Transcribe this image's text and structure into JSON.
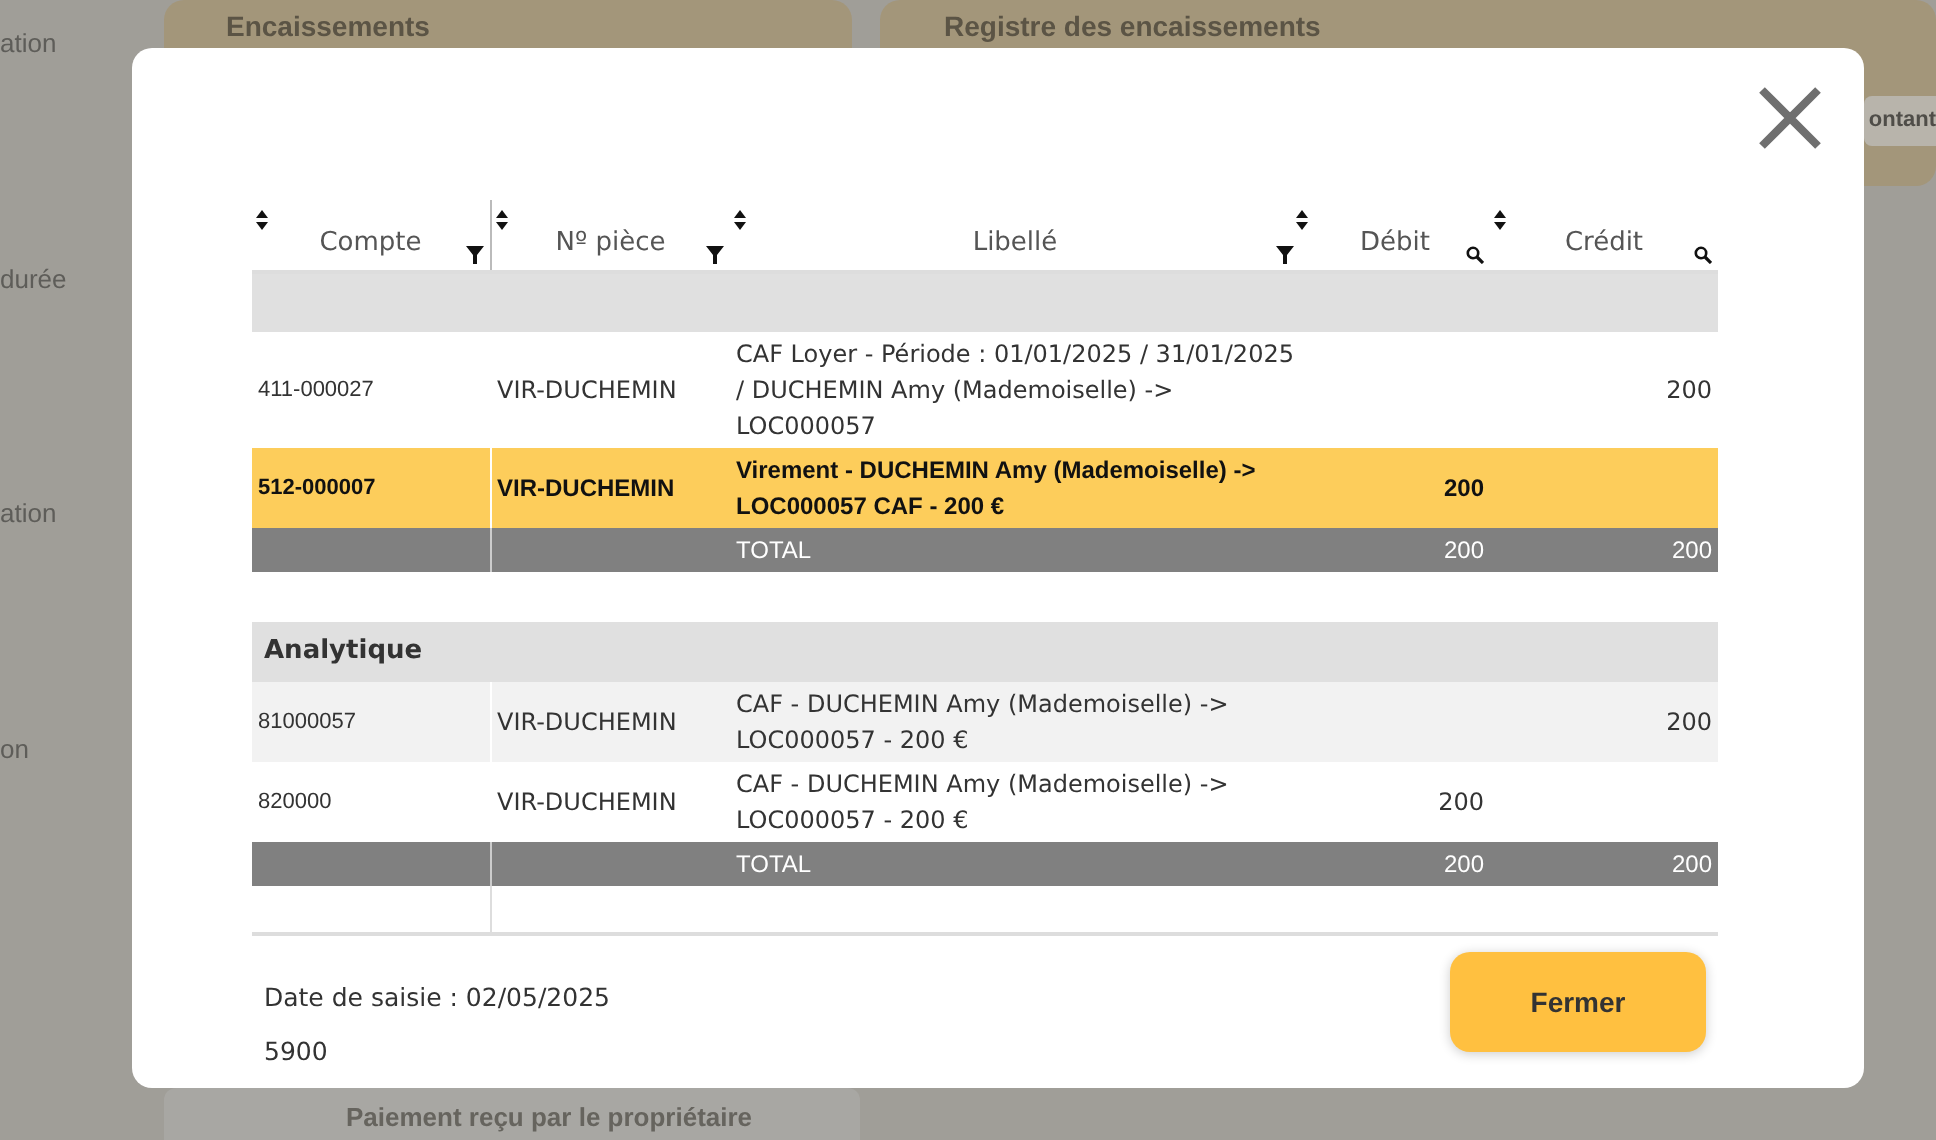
{
  "background": {
    "sidebar_items": [
      "ation",
      "durée",
      "ation",
      "on"
    ],
    "cards": [
      {
        "title": "Encaissements"
      },
      {
        "title": "Registre des encaissements",
        "chip": "ontant"
      }
    ],
    "bottom_card": {
      "title": "Paiement reçu par le propriétaire"
    }
  },
  "modal": {
    "columns": [
      {
        "label": "Compte",
        "filter": true,
        "search": false
      },
      {
        "label": "Nº pièce",
        "filter": true,
        "search": false
      },
      {
        "label": "Libellé",
        "filter": true,
        "search": false
      },
      {
        "label": "Débit",
        "filter": false,
        "search": true
      },
      {
        "label": "Crédit",
        "filter": false,
        "search": true
      }
    ],
    "sections": [
      {
        "rows": [
          {
            "account": "411-000027",
            "piece": "VIR-DUCHEMIN",
            "label": "CAF Loyer - Période : 01/01/2025 / 31/01/2025 / DUCHEMIN Amy (Mademoiselle) -> LOC000057",
            "credit": "200",
            "selected": false,
            "shaded": false
          },
          {
            "account": "512-000007",
            "piece": "VIR-DUCHEMIN",
            "label": "Virement - DUCHEMIN Amy (Mademoiselle) -> LOC000057 CAF - 200 €",
            "debit": "200",
            "selected": true
          }
        ],
        "total": {
          "label": "TOTAL",
          "debit": "200",
          "credit": "200"
        }
      },
      {
        "title": "Analytique",
        "rows": [
          {
            "account": "81000057",
            "piece": "VIR-DUCHEMIN",
            "label": "CAF - DUCHEMIN Amy (Mademoiselle) -> LOC000057 - 200 €",
            "credit": "200",
            "selected": false,
            "shaded": true
          },
          {
            "account": "820000",
            "piece": "VIR-DUCHEMIN",
            "label": "CAF - DUCHEMIN Amy (Mademoiselle) -> LOC000057 - 200 €",
            "debit": "200",
            "selected": false,
            "shaded": false
          }
        ],
        "total": {
          "label": "TOTAL",
          "debit": "200",
          "credit": "200"
        }
      }
    ],
    "entry_date": "Date de saisie : 02/05/2025",
    "number": "5900",
    "close_button": "Fermer"
  }
}
